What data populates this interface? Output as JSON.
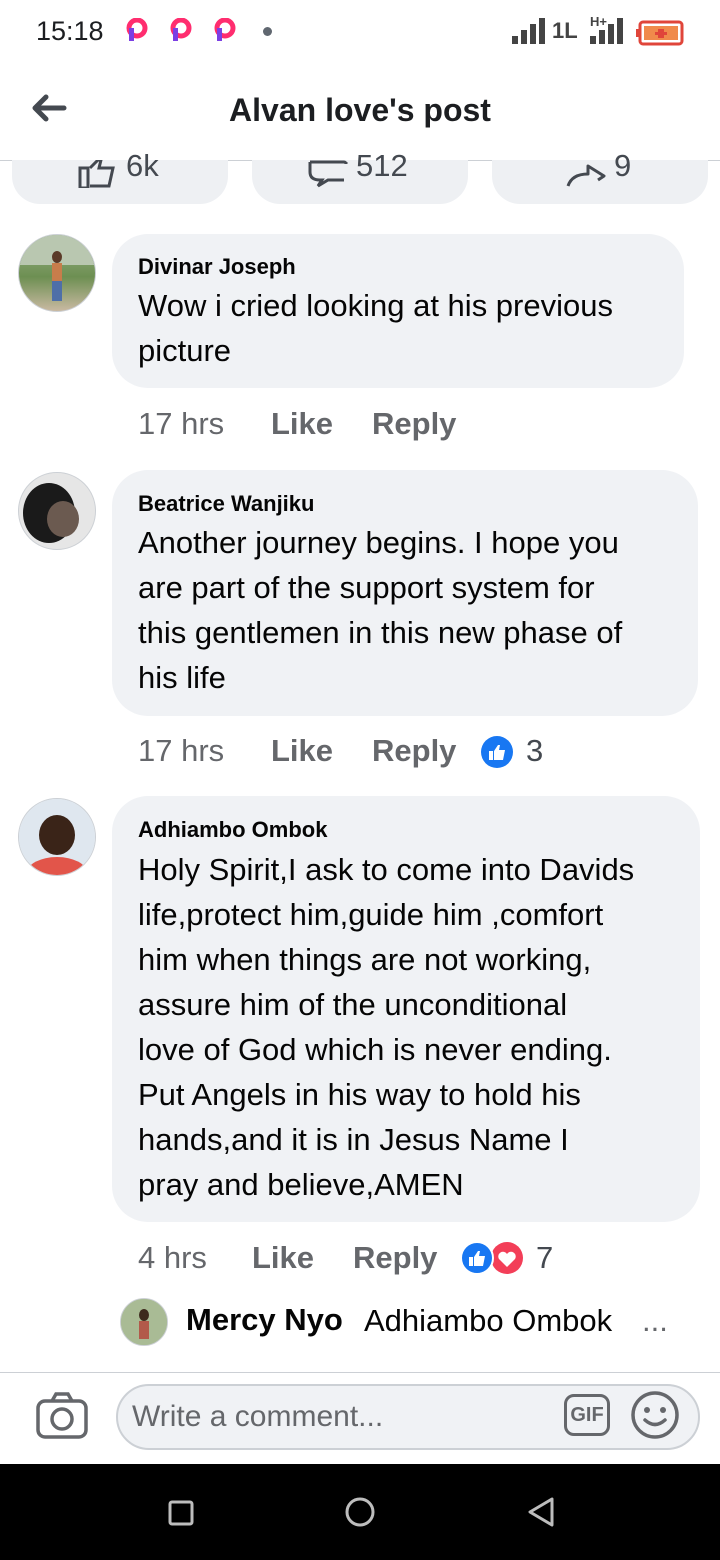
{
  "status_bar": {
    "time": "15:18",
    "network_label": "H+",
    "net2_label": "1L"
  },
  "header": {
    "title": "Alvan love's post"
  },
  "reactions": {
    "likes": "6k",
    "comments": "512",
    "shares": "9"
  },
  "comments": [
    {
      "author": "Divinar Joseph",
      "lines": [
        "Wow i cried looking at his previous",
        "picture"
      ],
      "time": "17 hrs",
      "like_label": "Like",
      "reply_label": "Reply",
      "reaction_count": ""
    },
    {
      "author": "Beatrice Wanjiku",
      "lines": [
        "Another journey begins. I hope you",
        "are part of the support system for",
        "this gentlemen in this new phase of",
        "his life"
      ],
      "time": "17 hrs",
      "like_label": "Like",
      "reply_label": "Reply",
      "reaction_count": "3"
    },
    {
      "author": "Adhiambo Ombok",
      "lines": [
        "Holy Spirit,I ask to come into Davids",
        "life,protect him,guide him ,comfort",
        "him when things are not working,",
        "assure him of the unconditional",
        "love of God which is never ending.",
        "Put Angels in his way to hold his",
        "hands,and it is in Jesus Name I",
        "pray and believe,AMEN"
      ],
      "time": "4 hrs",
      "like_label": "Like",
      "reply_label": "Reply",
      "reaction_count": "7"
    }
  ],
  "reply_preview": {
    "author": "Mercy Nyo",
    "text": "Adhiambo Ombok",
    "ellipsis": "..."
  },
  "composer": {
    "placeholder": "Write a comment...",
    "gif_label": "GIF"
  },
  "colors": {
    "like_blue": "#1877f2",
    "love_red": "#f33e58",
    "bubble_bg": "#f0f2f5",
    "meta_gray": "#65676b"
  }
}
